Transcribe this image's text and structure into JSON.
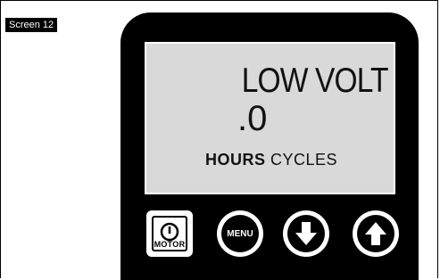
{
  "screen_label": "Screen 12",
  "display": {
    "line1": "LOW VOLT",
    "line2": ".0",
    "hours_label": "HOURS",
    "cycles_label": "CYCLES"
  },
  "buttons": {
    "motor": {
      "label": "MOTOR",
      "icon": "power-icon"
    },
    "menu": {
      "label": "MENU"
    },
    "down": {
      "icon": "down-arrow-icon"
    },
    "up": {
      "icon": "up-arrow-icon"
    }
  },
  "colors": {
    "bezel": "#000000",
    "lcd": "#d9d9d9",
    "text": "#111111"
  }
}
